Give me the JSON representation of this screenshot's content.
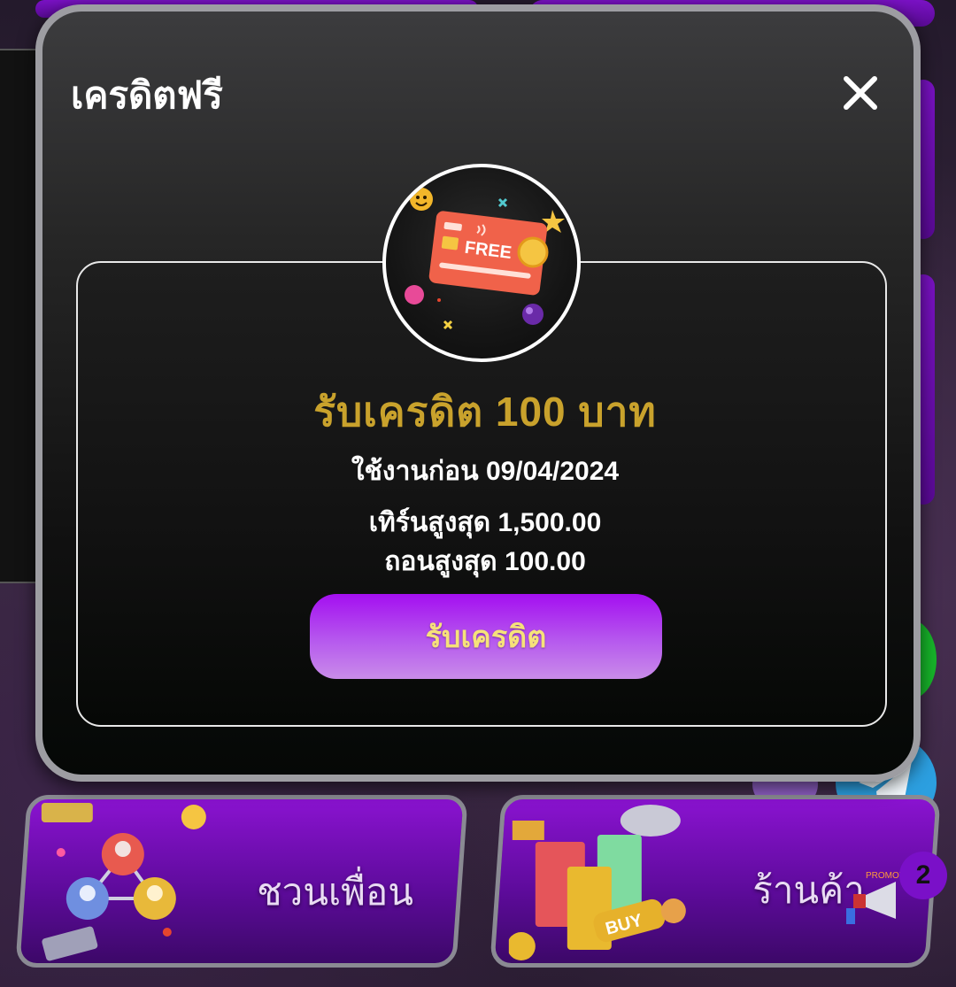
{
  "modal": {
    "title": "เครดิตฟรี",
    "emblem_text": "FREE",
    "reward_title": "รับเครดิต 100 บาท",
    "expiry_line": "ใช้งานก่อน 09/04/2024",
    "turnover_line": "เทิร์นสูงสุด 1,500.00",
    "withdraw_line": "ถอนสูงสุด 100.00",
    "claim_label": "รับเครดิต",
    "accent_gold": "#c9a22c",
    "button_purple": "#a40ff0"
  },
  "background": {
    "invite_card_label": "ชวนเพื่อน",
    "shop_card_label": "ร้านค้า",
    "shop_badge_count": "2",
    "promo_text": "PROMOTI",
    "buy_text": "BUY"
  },
  "icons": {
    "close": "close-icon",
    "credit_card": "credit-card-icon",
    "telegram": "telegram-icon",
    "megaphone": "megaphone-icon"
  }
}
